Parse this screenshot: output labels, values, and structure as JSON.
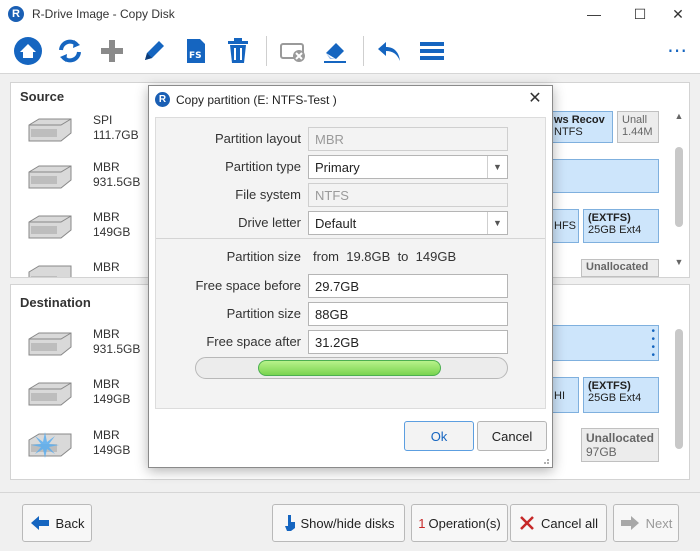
{
  "window": {
    "title": "R-Drive Image - Copy Disk",
    "logo": "R"
  },
  "toolbar": {
    "icons": [
      "home-icon",
      "refresh-icon",
      "add-icon",
      "edit-icon",
      "file-system-icon",
      "delete-icon",
      "disk-eject-icon",
      "eraser-icon",
      "undo-icon",
      "menu-icon"
    ],
    "accent": "#1565c0"
  },
  "source": {
    "title": "Source",
    "disks": [
      {
        "type": "SPI",
        "size": "111.7GB"
      },
      {
        "type": "MBR",
        "size": "931.5GB"
      },
      {
        "type": "MBR",
        "size": "149GB"
      },
      {
        "type": "MBR",
        "size": ""
      }
    ],
    "partitions": [
      {
        "name": "ws Recov",
        "detail": "NTFS"
      },
      {
        "name": "Unall",
        "detail": "1.44M"
      },
      {
        "name": "HFS",
        "detail": ""
      },
      {
        "name": "(EXTFS)",
        "detail": "25GB Ext4"
      },
      {
        "name": "Unallocated",
        "detail": ""
      }
    ]
  },
  "destination": {
    "title": "Destination",
    "disks": [
      {
        "type": "MBR",
        "size": "931.5GB"
      },
      {
        "type": "MBR",
        "size": "149GB"
      },
      {
        "type": "MBR",
        "size": "149GB"
      }
    ],
    "partitions": [
      {
        "name": "HI",
        "detail": ""
      },
      {
        "name": "(EXTFS)",
        "detail": "25GB Ext4"
      },
      {
        "name": "Unallocated",
        "detail": "97GB"
      }
    ]
  },
  "bottom": {
    "back": "Back",
    "show_hide": "Show/hide disks",
    "operations_count": "1",
    "operations_label": "Operation(s)",
    "cancel_all": "Cancel all",
    "next": "Next"
  },
  "dialog": {
    "title": "Copy partition (E: NTFS-Test )",
    "logo": "R",
    "partition_layout": {
      "label": "Partition layout",
      "value": "MBR"
    },
    "partition_type": {
      "label": "Partition type",
      "value": "Primary"
    },
    "file_system": {
      "label": "File system",
      "value": "NTFS"
    },
    "drive_letter": {
      "label": "Drive letter",
      "value": "Default"
    },
    "partition_size_range": {
      "label": "Partition size",
      "from_word": "from",
      "from": "19.8GB",
      "to_word": "to",
      "to": "149GB"
    },
    "free_before": {
      "label": "Free space before",
      "value": "29.7GB"
    },
    "partition_size": {
      "label": "Partition size",
      "value": "88GB"
    },
    "free_after": {
      "label": "Free space after",
      "value": "31.2GB"
    },
    "slider": {
      "before_fraction": 0.2,
      "partition_fraction": 0.59
    },
    "ok": "Ok",
    "cancel": "Cancel"
  }
}
